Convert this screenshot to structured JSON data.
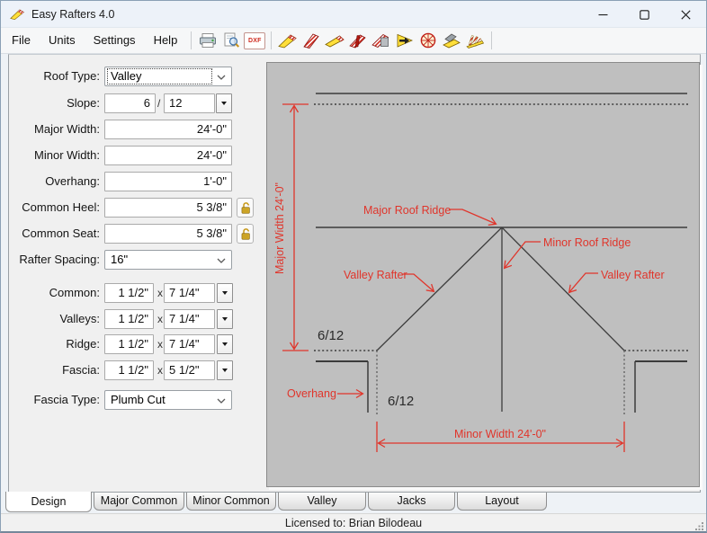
{
  "window": {
    "title": "Easy Rafters 4.0"
  },
  "menu": {
    "file": "File",
    "units": "Units",
    "settings": "Settings",
    "help": "Help"
  },
  "toolbar": {
    "dxf": "DXF",
    "icons": [
      "printer-icon",
      "print-preview-icon",
      "dxf-export",
      "common-rafter-icon",
      "hip-rafter-icon",
      "valley-rafter-icon",
      "jack-rafter-icon",
      "rafter-square-icon",
      "gable-roof-icon",
      "octagon-roof-icon",
      "shed-roof-icon",
      "fan-rafters-icon"
    ]
  },
  "form": {
    "roof_type": {
      "label": "Roof Type:",
      "value": "Valley"
    },
    "slope": {
      "label": "Slope:",
      "rise": "6",
      "divider": "/",
      "run": "12"
    },
    "major_width": {
      "label": "Major Width:",
      "value": "24'-0\""
    },
    "minor_width": {
      "label": "Minor Width:",
      "value": "24'-0\""
    },
    "overhang": {
      "label": "Overhang:",
      "value": "1'-0\""
    },
    "common_heel": {
      "label": "Common Heel:",
      "value": "5 3/8\""
    },
    "common_seat": {
      "label": "Common Seat:",
      "value": "5 3/8\""
    },
    "rafter_spacing": {
      "label": "Rafter Spacing:",
      "value": "16\""
    },
    "lumber": [
      {
        "label": "Common:",
        "width": "1 1/2\"",
        "x": "x",
        "depth": "7 1/4\""
      },
      {
        "label": "Valleys:",
        "width": "1 1/2\"",
        "x": "x",
        "depth": "7 1/4\""
      },
      {
        "label": "Ridge:",
        "width": "1 1/2\"",
        "x": "x",
        "depth": "7 1/4\""
      },
      {
        "label": "Fascia:",
        "width": "1 1/2\"",
        "x": "x",
        "depth": "5 1/2\""
      }
    ],
    "fascia_type": {
      "label": "Fascia Type:",
      "value": "Plumb Cut"
    }
  },
  "diagram": {
    "major_width_dim": "Major Width  24'-0\"",
    "major_roof_ridge": "Major Roof Ridge",
    "minor_roof_ridge": "Minor Roof Ridge",
    "valley_rafter_left": "Valley Rafter",
    "valley_rafter_right": "Valley Rafter",
    "slope_upper": "6/12",
    "slope_lower": "6/12",
    "overhang_label": "Overhang",
    "minor_width_dim": "Minor Width  24'-0\"",
    "colors": {
      "annotation": "#e0352b",
      "line": "#3c3c3c",
      "canvas": "#bfbfbf"
    }
  },
  "tabs": {
    "items": [
      "Design",
      "Major Common",
      "Minor Common",
      "Valley",
      "Jacks",
      "Layout"
    ],
    "active": "Design"
  },
  "status": {
    "text": "Licensed to: Brian Bilodeau"
  }
}
